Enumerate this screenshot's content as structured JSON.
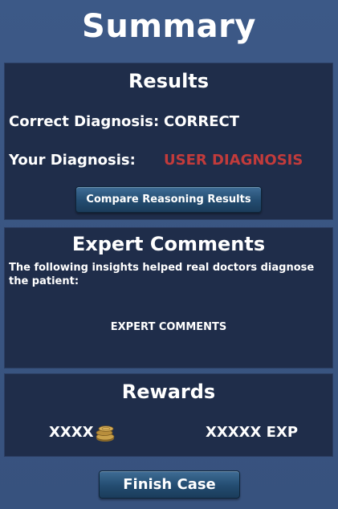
{
  "page": {
    "title": "Summary"
  },
  "results": {
    "title": "Results",
    "correct_label": "Correct Diagnosis:",
    "correct_value": "CORRECT",
    "your_label": "Your  Diagnosis:",
    "your_value": "USER DIAGNOSIS",
    "compare_button": "Compare Reasoning Results"
  },
  "expert": {
    "title": "Expert Comments",
    "insight": "The following insights helped real doctors diagnose the patient:",
    "comments": "EXPERT COMMENTS"
  },
  "rewards": {
    "title": "Rewards",
    "coins": "XXXX",
    "exp": "XXXXX EXP",
    "coin_icon": "coin-stack-icon"
  },
  "finish_button": "Finish Case",
  "colors": {
    "background": "#3a5582",
    "panel": "#1f2d4a",
    "user_diagnosis": "#c23b3b",
    "button": "#234c70",
    "coin": "#c8a04a"
  }
}
